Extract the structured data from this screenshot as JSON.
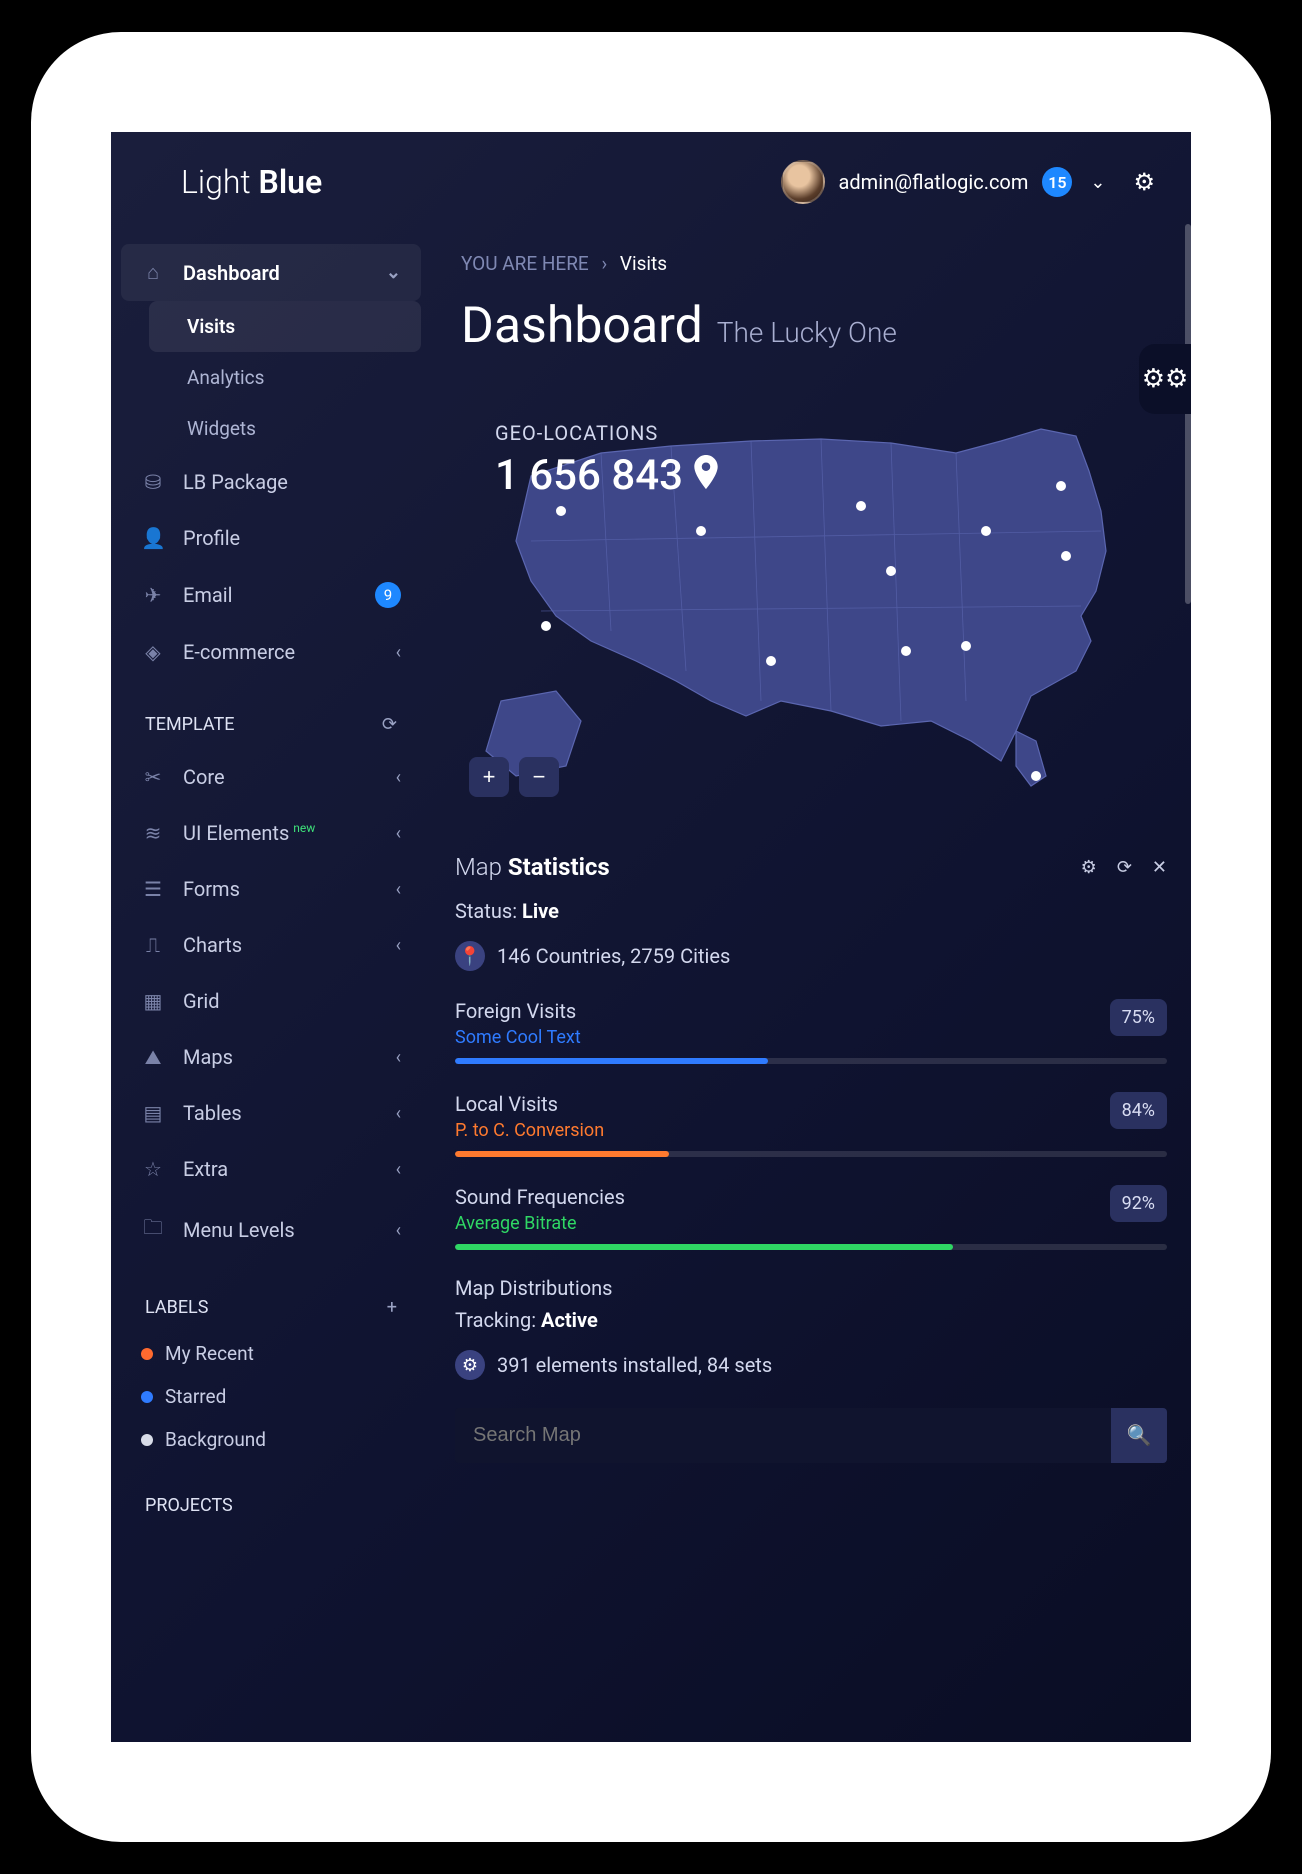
{
  "brand": {
    "thin": "Light",
    "bold": "Blue"
  },
  "header": {
    "user_email": "admin@flatlogic.com",
    "notif_count": "15"
  },
  "breadcrumb": {
    "label": "YOU ARE HERE",
    "current": "Visits"
  },
  "page": {
    "title": "Dashboard",
    "subtitle": "The Lucky One"
  },
  "sidebar": {
    "dashboard": {
      "label": "Dashboard"
    },
    "dashboard_children": {
      "visits": "Visits",
      "analytics": "Analytics",
      "widgets": "Widgets"
    },
    "items": {
      "lb_package": "LB Package",
      "profile": "Profile",
      "email": "Email",
      "email_badge": "9",
      "ecommerce": "E-commerce"
    },
    "template_header": "TEMPLATE",
    "template": {
      "core": "Core",
      "ui_elements": "UI Elements",
      "ui_new": "new",
      "forms": "Forms",
      "charts": "Charts",
      "grid": "Grid",
      "maps": "Maps",
      "tables": "Tables",
      "extra": "Extra",
      "menu_levels": "Menu Levels"
    },
    "labels_header": "LABELS",
    "labels": {
      "recent": "My Recent",
      "starred": "Starred",
      "background": "Background"
    },
    "projects_header": "PROJECTS"
  },
  "geo": {
    "label": "GEO-LOCATIONS",
    "value": "1 656 843"
  },
  "map_controls": {
    "zoom_in": "+",
    "zoom_out": "−"
  },
  "panel": {
    "title_light": "Map",
    "title_bold": "Statistics",
    "status_label": "Status:",
    "status_value": "Live",
    "countries_line": "146 Countries, 2759 Cities",
    "metrics": [
      {
        "name": "Foreign Visits",
        "sub": "Some Cool Text",
        "sub_color": "#2f7bff",
        "pct": "75%",
        "fill_pct": 44,
        "fill_color": "#2f7bff"
      },
      {
        "name": "Local Visits",
        "sub": "P. to C. Conversion",
        "sub_color": "#ff7a2f",
        "pct": "84%",
        "fill_pct": 30,
        "fill_color": "#ff7a2f"
      },
      {
        "name": "Sound Frequencies",
        "sub": "Average Bitrate",
        "sub_color": "#2fd764",
        "pct": "92%",
        "fill_pct": 70,
        "fill_color": "#2fd764"
      }
    ],
    "dist_label": "Map Distributions",
    "tracking_label": "Tracking:",
    "tracking_value": "Active",
    "elements_line": "391 elements installed, 84 sets",
    "search_placeholder": "Search Map"
  },
  "colors": {
    "label_recent": "#ff6a2f",
    "label_starred": "#2f7bff",
    "label_background": "#d8dce8"
  }
}
